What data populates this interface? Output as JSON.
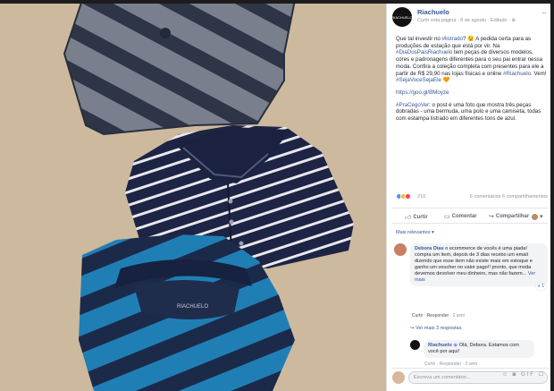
{
  "post": {
    "page_name": "Riachuelo",
    "page_avatar": "RIACHUELO",
    "meta": "Curtir esta página · 8 de agosto · Editado ·",
    "more": "···",
    "paragraph1_a": "Que tal investir no ",
    "paragraph1_tag1": "#listrado",
    "paragraph1_b": "? 😉 A pedida certa para as produções de estação que está por vir. Na ",
    "paragraph1_tag2": "#DiaDosPaisRiachuelo",
    "paragraph1_c": " tem peças de diversos modelos, cores e padronagens diferentes para o seu pai entrar nessa moda. Confira a coleção completa com presentes para ele a partir de R$ 29,90 nas lojas físicas e online ",
    "paragraph1_tag3": "#Riachuelo",
    "paragraph1_d": ". Vem! ",
    "paragraph1_tag4": "#SejaVoceSejaEle",
    "paragraph1_e": " 🧡",
    "link": "https://goo.gl/BMoyze",
    "paragraph3_tag": "#PraCegoVer",
    "paragraph3_text": ": o post é uma foto que mostra três peças dobradas - uma bermuda, uma polo e uma camiseta, todas com estampa listrado em diferentes tons de azul."
  },
  "reactions": {
    "count": "210",
    "summary": "6 comentários  6 compartilhamentos",
    "colors": [
      "#5890ff",
      "#f7b928",
      "#f33e58"
    ]
  },
  "actions": {
    "like": "Curtir",
    "comment": "Comentar",
    "share": "Compartilhar",
    "like_icon": "thumbs-up-icon",
    "comment_icon": "comment-icon",
    "share_icon": "share-icon"
  },
  "comments": {
    "sort_label": "Mais relevantes ▾",
    "first": {
      "author": "Debora Dias",
      "text": " o ecommerce de vocês é uma piada! compra um item, depois de 3 dias recebo um email dizendo que esse item não existe mais em estoque e ganho um voucher no valor pago!! pronto, que moda devemos devolver meu dinheiro, mas não fazem...",
      "see_more": "Ver mais",
      "footer_like": "Curtir",
      "footer_reply": "Responder",
      "footer_time": "2 sem",
      "likes": "1"
    },
    "replies_link": "↪ Ver mais 3 respostas",
    "reply": {
      "author": "Riachuelo",
      "text": " Olá, Debora. Estamos com você por aqui!",
      "footer": "Curtir · Responder · 2 sem"
    },
    "write_placeholder": "Escreva um comentário...",
    "write_icons": "☺ ◙ GIF ☐"
  }
}
